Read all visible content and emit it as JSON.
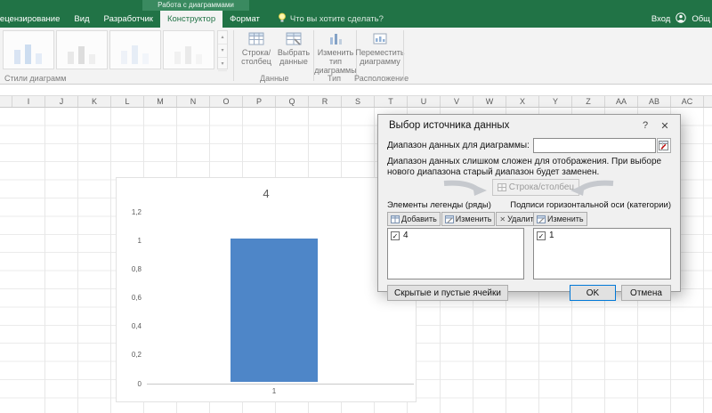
{
  "titlebar": {
    "contextual_header": "Работа с диаграммами"
  },
  "ribbon": {
    "tabs": [
      {
        "label": "Рецензирование",
        "active": false
      },
      {
        "label": "Вид",
        "active": false
      },
      {
        "label": "Разработчик",
        "active": false
      },
      {
        "label": "Конструктор",
        "active": true
      },
      {
        "label": "Формат",
        "active": false
      }
    ],
    "tell_me": "Что вы хотите сделать?",
    "signin": "Вход",
    "share": "Общ",
    "styles_group_label": "Стили диаграмм",
    "data_group_label": "Данные",
    "type_group_label": "Тип",
    "location_group_label": "Расположение",
    "switch_line1": "Строка/",
    "switch_line2": "столбец",
    "select_line1": "Выбрать",
    "select_line2": "данные",
    "change_type_line1": "Изменить тип",
    "change_type_line2": "диаграммы",
    "move_line1": "Переместить",
    "move_line2": "диаграмму",
    "gallery_up": "▴",
    "gallery_down": "▾",
    "gallery_more": "▾"
  },
  "sheet": {
    "columns": [
      "I",
      "J",
      "K",
      "L",
      "M",
      "N",
      "O",
      "P",
      "Q",
      "R",
      "S",
      "T",
      "U",
      "V",
      "W",
      "X",
      "Y",
      "Z",
      "AA",
      "AB",
      "AC"
    ]
  },
  "chart_data": {
    "type": "bar",
    "title": "4",
    "categories": [
      "1"
    ],
    "values": [
      1
    ],
    "ylim": [
      0,
      1.2
    ],
    "ytick_labels": [
      "1,2",
      "1",
      "0,8",
      "0,6",
      "0,4",
      "0,2",
      "0"
    ],
    "bar_color": "#4e86c8",
    "xlabel": "",
    "ylabel": ""
  },
  "dialog": {
    "title": "Выбор источника данных",
    "help_icon": "?",
    "close_icon": "✕",
    "range_label": "Диапазон данных для диаграммы:",
    "range_value": "",
    "warning": "Диапазон данных слишком сложен для отображения. При выборе нового диапазона старый диапазон будет заменен.",
    "switch_button": "Строка/столбец",
    "check_icon": "✓",
    "legend": {
      "label": "Элементы легенды (ряды)",
      "add": "Добавить",
      "edit": "Изменить",
      "remove": "Удалить",
      "remove_icon": "✕",
      "up_icon": "▲",
      "down_icon": "▼",
      "items": [
        {
          "checked": true,
          "label": "4"
        }
      ]
    },
    "axis": {
      "label": "Подписи горизонтальной оси (категории)",
      "edit": "Изменить",
      "items": [
        {
          "checked": true,
          "label": "1"
        }
      ]
    },
    "hidden_cells": "Скрытые и пустые ячейки",
    "ok": "OK",
    "cancel": "Отмена"
  }
}
